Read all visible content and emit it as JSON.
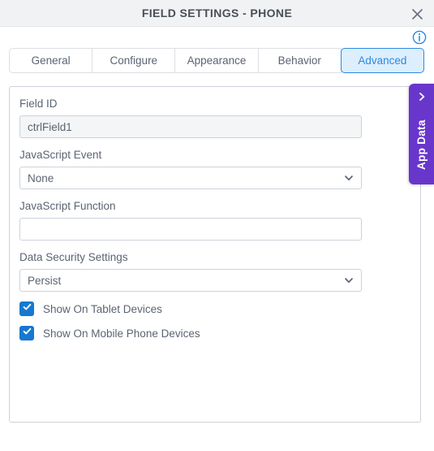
{
  "window": {
    "title": "FIELD SETTINGS - PHONE",
    "close_icon": "close-icon",
    "info_icon": "info-icon"
  },
  "tabs": [
    {
      "label": "General",
      "active": false
    },
    {
      "label": "Configure",
      "active": false
    },
    {
      "label": "Appearance",
      "active": false
    },
    {
      "label": "Behavior",
      "active": false
    },
    {
      "label": "Advanced",
      "active": true
    }
  ],
  "form": {
    "field_id": {
      "label": "Field ID",
      "value": "ctrlField1",
      "placeholder": "",
      "readonly": true
    },
    "javascript_event": {
      "label": "JavaScript Event",
      "value": "None",
      "options": [
        "None"
      ]
    },
    "javascript_function": {
      "label": "JavaScript Function",
      "value": "",
      "placeholder": ""
    },
    "data_security_settings": {
      "label": "Data Security Settings",
      "value": "Persist",
      "options": [
        "Persist"
      ]
    },
    "checkboxes": [
      {
        "label": "Show On Tablet Devices",
        "checked": true
      },
      {
        "label": "Show On Mobile Phone Devices",
        "checked": true
      }
    ]
  },
  "side_panel": {
    "label": "App Data",
    "collapse_icon": "chevron-left-icon"
  },
  "colors": {
    "accent_blue": "#2a8ae0",
    "active_tab_bg": "#ddeefc",
    "checkbox_blue": "#1778d0",
    "app_data_purple": "#6936cc",
    "titlebar_bg": "#f1f2f3",
    "text_gray": "#5b6472",
    "border_gray": "#ccd2da"
  }
}
